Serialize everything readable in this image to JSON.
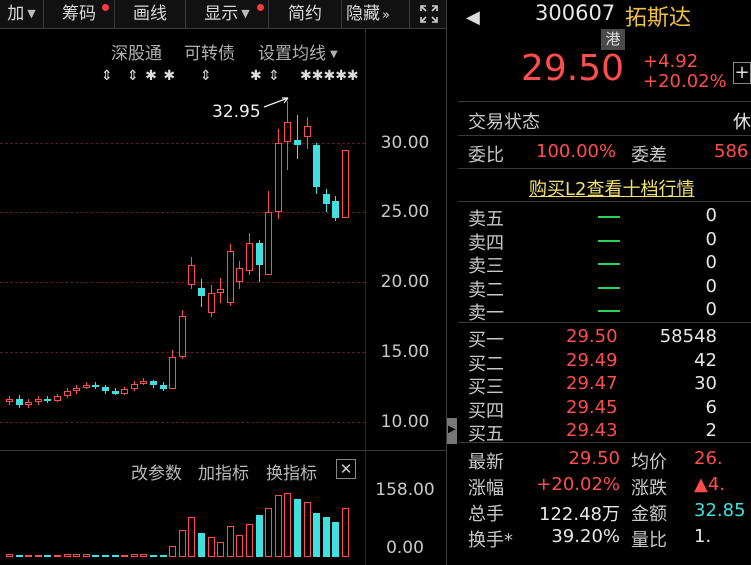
{
  "toolbar": {
    "items": [
      {
        "label": "加",
        "dot": false,
        "arrow": true
      },
      {
        "label": "筹码",
        "dot": true,
        "arrow": false
      },
      {
        "label": "画线",
        "dot": false,
        "arrow": false
      },
      {
        "label": "显示",
        "dot": true,
        "arrow": true
      },
      {
        "label": "简约",
        "dot": false,
        "arrow": false
      },
      {
        "label": "隐藏",
        "dot": false,
        "arrow": false
      }
    ],
    "more_icon": "»",
    "expand_icon": "expand-icon"
  },
  "chart_links": [
    "深股通",
    "可转债",
    "设置均线"
  ],
  "annotation_high": "32.95",
  "y_ticks": [
    "30.00",
    "25.00",
    "20.00",
    "15.00",
    "10.00"
  ],
  "volume_panel": {
    "buttons": [
      "改参数",
      "加指标",
      "换指标"
    ],
    "y_ticks": [
      "158.00",
      "0.00"
    ]
  },
  "chart_data": {
    "type": "candlestick",
    "ylim": [
      8.2,
      35.1
    ],
    "y_ticks": [
      10,
      15,
      20,
      25,
      30
    ],
    "high_marker": 32.95,
    "candles": [
      {
        "o": 11.4,
        "c": 11.6,
        "h": 11.8,
        "l": 11.2
      },
      {
        "o": 11.6,
        "c": 11.2,
        "h": 11.9,
        "l": 11.0
      },
      {
        "o": 11.2,
        "c": 11.4,
        "h": 11.6,
        "l": 11.0
      },
      {
        "o": 11.4,
        "c": 11.6,
        "h": 11.8,
        "l": 11.2
      },
      {
        "o": 11.6,
        "c": 11.5,
        "h": 11.8,
        "l": 11.3
      },
      {
        "o": 11.5,
        "c": 11.8,
        "h": 12.0,
        "l": 11.4
      },
      {
        "o": 11.8,
        "c": 12.2,
        "h": 12.4,
        "l": 11.7
      },
      {
        "o": 12.2,
        "c": 12.4,
        "h": 12.6,
        "l": 12.0
      },
      {
        "o": 12.4,
        "c": 12.6,
        "h": 12.8,
        "l": 12.3
      },
      {
        "o": 12.6,
        "c": 12.5,
        "h": 12.8,
        "l": 12.3
      },
      {
        "o": 12.5,
        "c": 12.2,
        "h": 12.6,
        "l": 12.0
      },
      {
        "o": 12.2,
        "c": 12.0,
        "h": 12.4,
        "l": 11.9
      },
      {
        "o": 12.0,
        "c": 12.3,
        "h": 12.5,
        "l": 11.9
      },
      {
        "o": 12.3,
        "c": 12.7,
        "h": 12.9,
        "l": 12.2
      },
      {
        "o": 12.7,
        "c": 12.9,
        "h": 13.1,
        "l": 12.6
      },
      {
        "o": 12.9,
        "c": 12.6,
        "h": 13.0,
        "l": 12.4
      },
      {
        "o": 12.6,
        "c": 12.3,
        "h": 12.8,
        "l": 12.2
      },
      {
        "o": 12.3,
        "c": 14.6,
        "h": 15.1,
        "l": 12.3
      },
      {
        "o": 14.6,
        "c": 17.6,
        "h": 18.0,
        "l": 14.5
      },
      {
        "o": 19.8,
        "c": 21.2,
        "h": 21.8,
        "l": 19.5
      },
      {
        "o": 19.6,
        "c": 19.0,
        "h": 20.2,
        "l": 18.2
      },
      {
        "o": 17.8,
        "c": 19.2,
        "h": 19.8,
        "l": 17.5
      },
      {
        "o": 19.2,
        "c": 19.5,
        "h": 20.3,
        "l": 18.5
      },
      {
        "o": 18.5,
        "c": 22.2,
        "h": 22.7,
        "l": 18.3
      },
      {
        "o": 20.0,
        "c": 21.0,
        "h": 21.5,
        "l": 19.5
      },
      {
        "o": 20.8,
        "c": 22.8,
        "h": 23.5,
        "l": 20.5
      },
      {
        "o": 22.8,
        "c": 21.2,
        "h": 23.0,
        "l": 20.0
      },
      {
        "o": 20.5,
        "c": 25.0,
        "h": 26.5,
        "l": 20.5
      },
      {
        "o": 25.0,
        "c": 30.0,
        "h": 31.0,
        "l": 24.5
      },
      {
        "o": 30.0,
        "c": 31.5,
        "h": 32.95,
        "l": 28.0
      },
      {
        "o": 30.2,
        "c": 29.8,
        "h": 32.0,
        "l": 28.8
      },
      {
        "o": 30.4,
        "c": 31.2,
        "h": 31.8,
        "l": 29.5
      },
      {
        "o": 29.8,
        "c": 26.8,
        "h": 30.0,
        "l": 26.3
      },
      {
        "o": 26.3,
        "c": 25.6,
        "h": 26.7,
        "l": 25.0
      },
      {
        "o": 25.8,
        "c": 24.6,
        "h": 26.2,
        "l": 24.4
      },
      {
        "o": 24.6,
        "c": 29.5,
        "h": 29.5,
        "l": 24.6
      }
    ],
    "volume_ylim": [
      0,
      158
    ],
    "volumes": [
      6,
      5,
      4,
      4,
      5,
      5,
      6,
      7,
      6,
      5,
      5,
      4,
      5,
      6,
      6,
      5,
      4,
      25,
      60,
      90,
      55,
      45,
      35,
      70,
      50,
      75,
      95,
      110,
      140,
      145,
      130,
      125,
      100,
      90,
      80,
      110
    ]
  },
  "right_panel": {
    "stock": {
      "code": "300607",
      "name": "拓斯达",
      "tag": "港",
      "price": "29.50",
      "change": "+4.92",
      "change_pct": "+20.02%",
      "add_icon": "plus-icon"
    },
    "status_label": "交易状态",
    "status_value": "休",
    "ratio_label": "委比",
    "ratio_value": "100.00%",
    "diff_label": "委差",
    "diff_value": "586",
    "l2_link": "购买L2查看十档行情",
    "sell": [
      {
        "label": "卖五",
        "vol": "0"
      },
      {
        "label": "卖四",
        "vol": "0"
      },
      {
        "label": "卖三",
        "vol": "0"
      },
      {
        "label": "卖二",
        "vol": "0"
      },
      {
        "label": "卖一",
        "vol": "0"
      }
    ],
    "buy": [
      {
        "label": "买一",
        "price": "29.50",
        "vol": "58548"
      },
      {
        "label": "买二",
        "price": "29.49",
        "vol": "42"
      },
      {
        "label": "买三",
        "price": "29.47",
        "vol": "30"
      },
      {
        "label": "买四",
        "price": "29.45",
        "vol": "6"
      },
      {
        "label": "买五",
        "price": "29.43",
        "vol": "2"
      }
    ],
    "stats": [
      {
        "l1": "最新",
        "v1": "29.50",
        "l2": "均价",
        "v2": "26."
      },
      {
        "l1": "涨幅",
        "v1": "+20.02%",
        "l2": "涨跌",
        "v2": "▲4."
      },
      {
        "l1": "总手",
        "v1": "122.48万",
        "l2": "金额",
        "v2": "32.85"
      },
      {
        "l1": "换手*",
        "v1": "39.20%",
        "l2": "量比",
        "v2": "1."
      }
    ]
  }
}
